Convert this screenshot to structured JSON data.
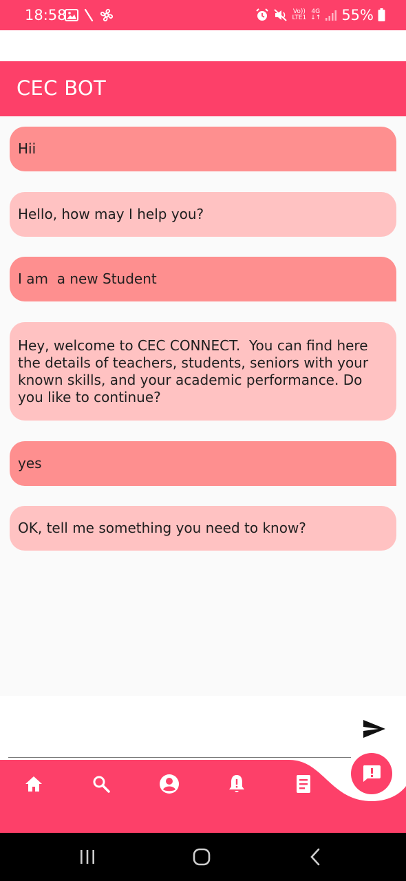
{
  "status_bar": {
    "time": "18:58",
    "battery": "55%",
    "network_top": "Vo))",
    "network_bottom": "LTE1",
    "network_type": "4G",
    "icons": [
      "gallery-icon",
      "signal-slash-icon",
      "pinwheel-icon",
      "alarm-icon",
      "mute-icon",
      "signal-bars-icon",
      "battery-icon"
    ]
  },
  "app": {
    "title": "CEC BOT",
    "accent_color": "#fd4069",
    "user_bubble_color": "#fe8f8f",
    "bot_bubble_color": "#ffc2c2"
  },
  "messages": [
    {
      "sender": "user",
      "text": "Hii"
    },
    {
      "sender": "bot",
      "text": "Hello, how may I help you?"
    },
    {
      "sender": "user",
      "text": "I am  a new Student"
    },
    {
      "sender": "bot",
      "text": "Hey, welcome to CEC CONNECT.  You can find here the details of teachers, students, seniors with your known skills, and your academic performance. Do you like to continue?"
    },
    {
      "sender": "user",
      "text": "yes"
    },
    {
      "sender": "bot",
      "text": "OK, tell me something you need to know?"
    }
  ],
  "input": {
    "value": "",
    "send_icon": "send-icon"
  },
  "bottom_nav": {
    "items": [
      "home-icon",
      "search-icon",
      "account-icon",
      "notification-alert-icon",
      "document-icon"
    ],
    "fab_icon": "feedback-icon"
  },
  "system_nav": [
    "recents-icon",
    "home-circle-icon",
    "back-icon"
  ]
}
